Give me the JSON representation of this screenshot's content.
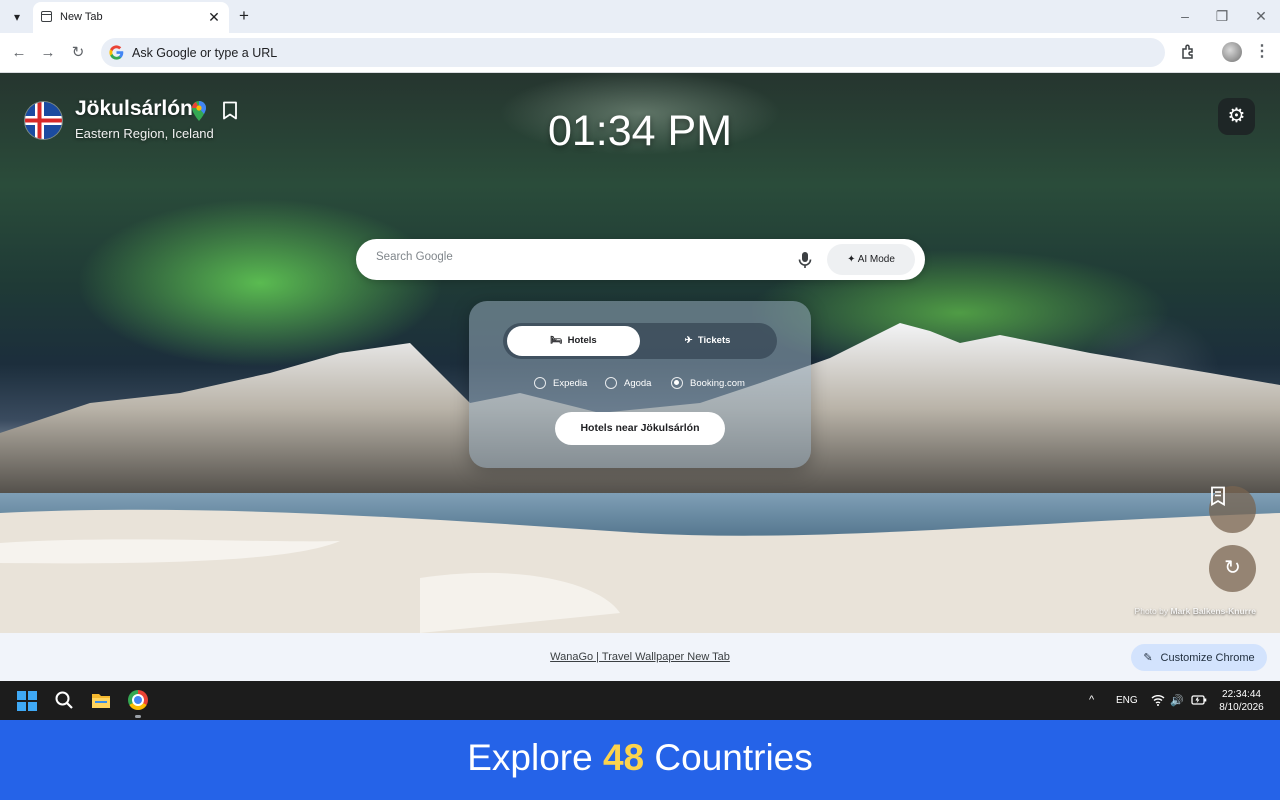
{
  "browser": {
    "tab_title": "New Tab",
    "omnibox_placeholder": "Ask Google or type a URL"
  },
  "location": {
    "name": "Jökulsárlón",
    "region": "Eastern Region, Iceland"
  },
  "clock": "01:34 PM",
  "search": {
    "placeholder": "Search Google",
    "ai_mode_label": "AI Mode"
  },
  "booking": {
    "tabs": [
      {
        "label": "Hotels",
        "selected": true
      },
      {
        "label": "Tickets",
        "selected": false
      }
    ],
    "providers": [
      {
        "label": "Expedia",
        "selected": false
      },
      {
        "label": "Agoda",
        "selected": false
      },
      {
        "label": "Booking.com",
        "selected": true
      }
    ],
    "cta_label": "Hotels near Jökulsárlón"
  },
  "photo_credit": {
    "prefix": "Photo by",
    "author": "Mark Balkens-Knurre"
  },
  "footer": {
    "link_text": "WanaGo | Travel Wallpaper New Tab",
    "customize_label": "Customize Chrome"
  },
  "taskbar": {
    "language": "ENG",
    "time": "22:34:44",
    "date": "8/10/2026"
  },
  "banner": {
    "before": "Explore",
    "count": "48",
    "after": "Countries",
    "count_color": "#fcd34d"
  },
  "colors": {
    "banner_bg": "#2563e8",
    "omnibox_bg": "#e9eef6",
    "customize_bg": "#d3e3fd"
  },
  "icons": [
    "tab-search-icon",
    "page-icon",
    "close-icon",
    "plus-icon",
    "minimize-icon",
    "maximize-icon",
    "back-icon",
    "forward-icon",
    "reload-icon",
    "google-icon",
    "extensions-icon",
    "avatar",
    "more-icon",
    "iceland-flag-icon",
    "map-pin-icon",
    "bookmark-icon",
    "gear-icon",
    "mic-icon",
    "sparkle-icon",
    "bed-icon",
    "plane-icon",
    "bookmarks-icon",
    "refresh-icon",
    "pencil-icon",
    "windows-start-icon",
    "search-icon",
    "folder-icon",
    "chrome-icon",
    "chevron-up-icon",
    "wifi-icon",
    "volume-icon",
    "battery-icon"
  ]
}
